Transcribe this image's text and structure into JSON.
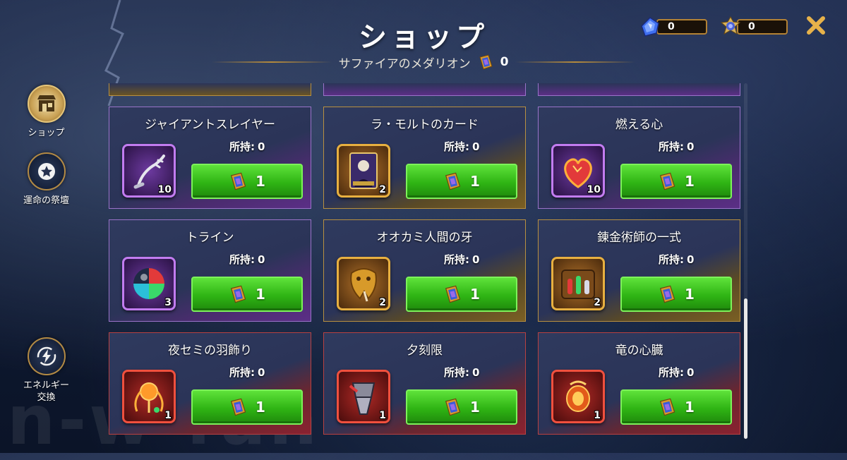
{
  "header": {
    "title": "ショップ",
    "subtitle": "サファイアのメダリオン",
    "subtitle_count": "0"
  },
  "currencies": [
    {
      "icon": "sapphire-gem-icon",
      "value": "0"
    },
    {
      "icon": "medallion-icon",
      "value": "0"
    }
  ],
  "close_icon": "close-icon",
  "nav": {
    "shop_label": "ショップ",
    "altar_label": "運命の祭壇",
    "energy_label_1": "エネルギー",
    "energy_label_2": "交換"
  },
  "watermark": "n-w-fun",
  "owned_label": "所持:",
  "items": [
    {
      "name": "ジャイアントスレイヤー",
      "owned": "0",
      "qty": "10",
      "price": "1",
      "rarity": "purple",
      "icon": "giant-slayer-icon"
    },
    {
      "name": "ラ・モルトのカード",
      "owned": "0",
      "qty": "2",
      "price": "1",
      "rarity": "gold",
      "icon": "death-card-icon"
    },
    {
      "name": "燃える心",
      "owned": "0",
      "qty": "10",
      "price": "1",
      "rarity": "purple",
      "icon": "burning-heart-icon"
    },
    {
      "name": "トライン",
      "owned": "0",
      "qty": "3",
      "price": "1",
      "rarity": "purple",
      "icon": "orb-icon"
    },
    {
      "name": "オオカミ人間の牙",
      "owned": "0",
      "qty": "2",
      "price": "1",
      "rarity": "gold",
      "icon": "werewolf-fang-icon"
    },
    {
      "name": "錬金術師の一式",
      "owned": "0",
      "qty": "2",
      "price": "1",
      "rarity": "gold",
      "icon": "alchemist-kit-icon"
    },
    {
      "name": "夜セミの羽飾り",
      "owned": "0",
      "qty": "1",
      "price": "1",
      "rarity": "red",
      "icon": "cicada-ornament-icon"
    },
    {
      "name": "夕刻限",
      "owned": "0",
      "qty": "1",
      "price": "1",
      "rarity": "red",
      "icon": "dusk-blade-icon"
    },
    {
      "name": "竜の心臓",
      "owned": "0",
      "qty": "1",
      "price": "1",
      "rarity": "red",
      "icon": "dragon-heart-icon"
    }
  ],
  "colors": {
    "purple": "#9a73c9",
    "gold": "#b89040",
    "red": "#b84141",
    "buy_green": "#2fb414",
    "accent_gold": "#e7b24a"
  }
}
